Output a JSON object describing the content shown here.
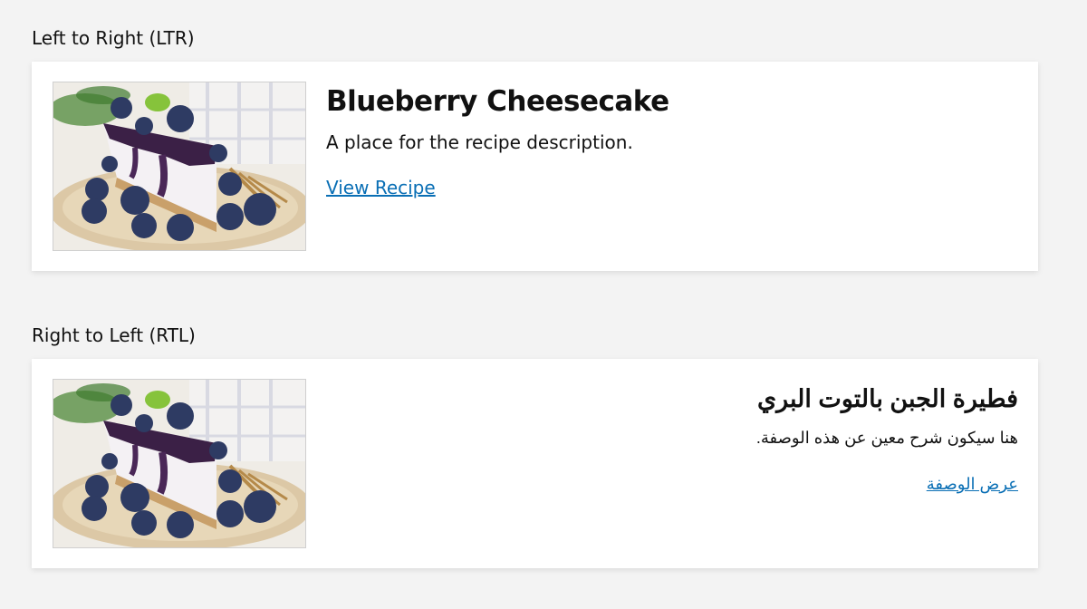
{
  "sections": {
    "ltr": {
      "label": "Left to Right (LTR)",
      "card": {
        "title": "Blueberry Cheesecake",
        "description": "A place for the recipe description.",
        "link_text": "View Recipe",
        "image_alt": "recipe-photo-blueberry-cheesecake"
      }
    },
    "rtl": {
      "label": "Right to Left (RTL)",
      "card": {
        "title": "فطيرة الجبن بالتوت البري",
        "description": "هنا سيكون شرح معين عن هذه الوصفة.",
        "link_text": "عرض الوصفة",
        "image_alt": "recipe-photo-blueberry-cheesecake"
      }
    }
  },
  "colors": {
    "page_background": "#f3f3f3",
    "card_background": "#ffffff",
    "link": "#0a6fb5",
    "text": "#111111"
  }
}
